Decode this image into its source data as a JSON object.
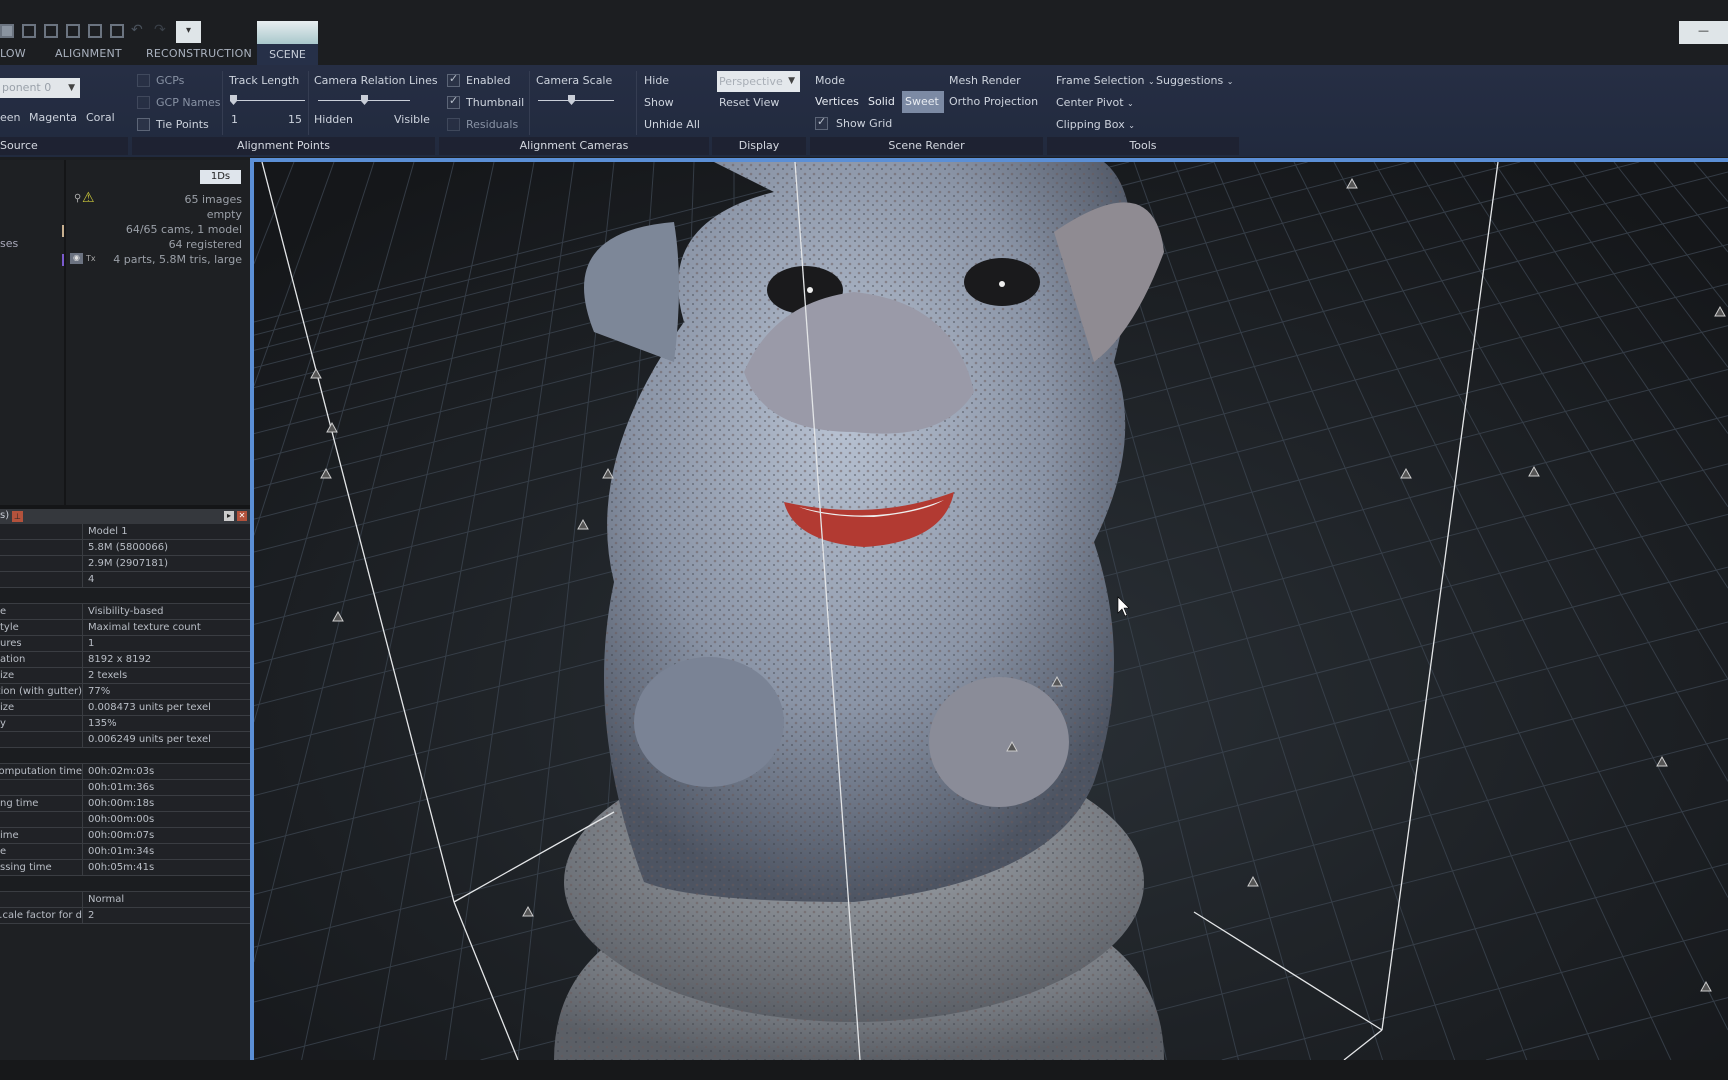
{
  "topbar": {
    "layout_icons": [
      "layout-single-icon",
      "layout-split-icon",
      "layout-2x1-icon",
      "layout-grid-icon",
      "layout-3pane-icon",
      "layout-9grid-icon"
    ],
    "undo_icon": "undo-icon",
    "redo_icon": "redo-icon",
    "quick_access_icon": "quick-access-dropdown-icon",
    "tabs": [
      {
        "label": "LOW"
      },
      {
        "label": "ALIGNMENT"
      },
      {
        "label": "RECONSTRUCTION"
      },
      {
        "label": "SCENE",
        "active": true
      }
    ],
    "minimize_label": "—"
  },
  "ribbon": {
    "source": {
      "component_select": "ponent 0",
      "colors": [
        "een",
        "Magenta",
        "Coral"
      ],
      "label": "Source"
    },
    "alignment_points": {
      "checkboxes": [
        {
          "label": "GCPs",
          "checked": false,
          "disabled": true
        },
        {
          "label": "GCP Names",
          "checked": false,
          "disabled": true
        },
        {
          "label": "Tie Points",
          "checked": false
        }
      ],
      "track_length": {
        "label": "Track Length",
        "min": "1",
        "max": "15",
        "value": 1
      },
      "camera_relation": {
        "label": "Camera Relation Lines",
        "min": "Hidden",
        "max": "Visible",
        "value": 0.5
      },
      "label": "Alignment Points"
    },
    "alignment_cameras": {
      "checkboxes": [
        {
          "label": "Enabled",
          "checked": true
        },
        {
          "label": "Thumbnail",
          "checked": true
        },
        {
          "label": "Residuals",
          "checked": false,
          "disabled": true
        }
      ],
      "camera_scale": {
        "label": "Camera Scale",
        "value": 0.4
      },
      "actions": [
        "Hide",
        "Show",
        "Unhide All"
      ],
      "label": "Alignment Cameras"
    },
    "display": {
      "projection": "Perspective",
      "reset": "Reset View",
      "label": "Display"
    },
    "scene_render": {
      "mode": "Mode",
      "modes": [
        "Vertices",
        "Solid",
        "Sweet"
      ],
      "active_mode": "Sweet",
      "mesh_render": "Mesh Render",
      "ortho": "Ortho Projection",
      "show_grid": "Show Grid",
      "show_grid_checked": true,
      "label": "Scene Render"
    },
    "tools": {
      "frame_selection": "Frame Selection",
      "suggestions": "Suggestions",
      "center_pivot": "Center Pivot",
      "clipping_box": "Clipping Box",
      "label": "Tools"
    }
  },
  "project_panel": {
    "badge": "1Ds",
    "left_items": [
      "ses"
    ],
    "summary": [
      "65 images",
      "empty",
      "64/65 cams, 1 model",
      "64 registered",
      "4 parts, 5.8M tris, large"
    ],
    "texture_label": "Tx"
  },
  "properties_panel": {
    "title": "s)",
    "rows": [
      {
        "k": "",
        "v": "Model 1"
      },
      {
        "k": "",
        "v": "5.8M (5800066)"
      },
      {
        "k": "",
        "v": "2.9M (2907181)"
      },
      {
        "k": "",
        "v": "4"
      },
      {
        "section": true
      },
      {
        "k": "e",
        "v": "Visibility-based"
      },
      {
        "k": "tyle",
        "v": "Maximal texture count"
      },
      {
        "k": "ures",
        "v": "1"
      },
      {
        "k": "ation",
        "v": "8192 x 8192"
      },
      {
        "k": "ize",
        "v": "2 texels"
      },
      {
        "k": "ation (with gutter)",
        "v": "77%"
      },
      {
        "k": "ize",
        "v": "0.008473 units per texel"
      },
      {
        "k": "y",
        "v": "135%"
      },
      {
        "k": "",
        "v": "0.006249 units per texel"
      },
      {
        "section": true
      },
      {
        "k": "omputation time",
        "v": "00h:02m:03s"
      },
      {
        "k": "",
        "v": "00h:01m:36s"
      },
      {
        "k": "ng time",
        "v": "00h:00m:18s"
      },
      {
        "k": "",
        "v": "00h:00m:00s"
      },
      {
        "k": "ime",
        "v": "00h:00m:07s"
      },
      {
        "k": "e",
        "v": "00h:01m:34s"
      },
      {
        "k": "ssing time",
        "v": "00h:05m:41s"
      },
      {
        "section": true
      },
      {
        "k": "",
        "v": "Normal"
      },
      {
        "k": "cale factor for d...",
        "v": "2"
      }
    ]
  },
  "colors": {
    "accent": "#5b8fd6",
    "ribbon": "#232b3f",
    "warning": "#c8c43a"
  }
}
